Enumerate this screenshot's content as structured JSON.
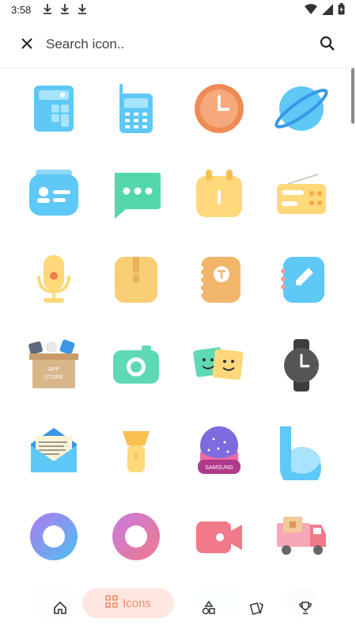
{
  "status": {
    "time": "3:58",
    "downloads": [
      "download-icon",
      "download-icon",
      "download-icon"
    ]
  },
  "search": {
    "placeholder": "Search icon.."
  },
  "nav": {
    "icons_label": "Icons"
  },
  "colors": {
    "accent": "#f28b6c",
    "pill": "#fde7e0"
  },
  "icons": [
    "calculator-icon",
    "phone-icon",
    "clock-icon",
    "browser-icon",
    "contacts-icon",
    "messages-icon",
    "calendar-icon",
    "radio-icon",
    "microphone-icon",
    "archive-icon",
    "notes-icon",
    "notebook-icon",
    "app-store-icon",
    "camera-icon",
    "photos-icon",
    "watch-icon",
    "email-icon",
    "flashlight-icon",
    "samsung-themes-icon",
    "bixby-icon",
    "circle-blue-icon",
    "circle-pink-icon",
    "video-icon",
    "delivery-truck-icon"
  ]
}
